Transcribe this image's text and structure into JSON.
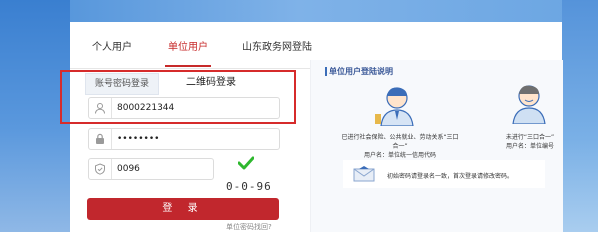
{
  "tabs": [
    {
      "label": "个人用户",
      "active": false
    },
    {
      "label": "单位用户",
      "active": true
    },
    {
      "label": "山东政务网登陆",
      "active": false
    }
  ],
  "login_modes": {
    "password": "账号密码登录",
    "qrcode": "二维码登录"
  },
  "form": {
    "account_value": "8000221344",
    "password_value": "••••••••",
    "captcha_value": "0096",
    "captcha_image_text": "0-0-96"
  },
  "login_button": "登 录",
  "forgot_link": "单位密码找回?",
  "info_panel": {
    "title": "单位用户登陆说明",
    "left_caption_line1": "已进行社会保险、公共就业、劳动关系“三口合一”",
    "left_caption_line2": "用户名：单位统一信用代码",
    "right_caption_line1": "未进行“三口合一”",
    "right_caption_line2": "用户名：单位编号",
    "notice": "初始密码请登录名一致，首次登录请修改密码。"
  },
  "colors": {
    "accent": "#c1272d",
    "highlight_border": "#d62b2b",
    "check": "#2eb82e"
  }
}
